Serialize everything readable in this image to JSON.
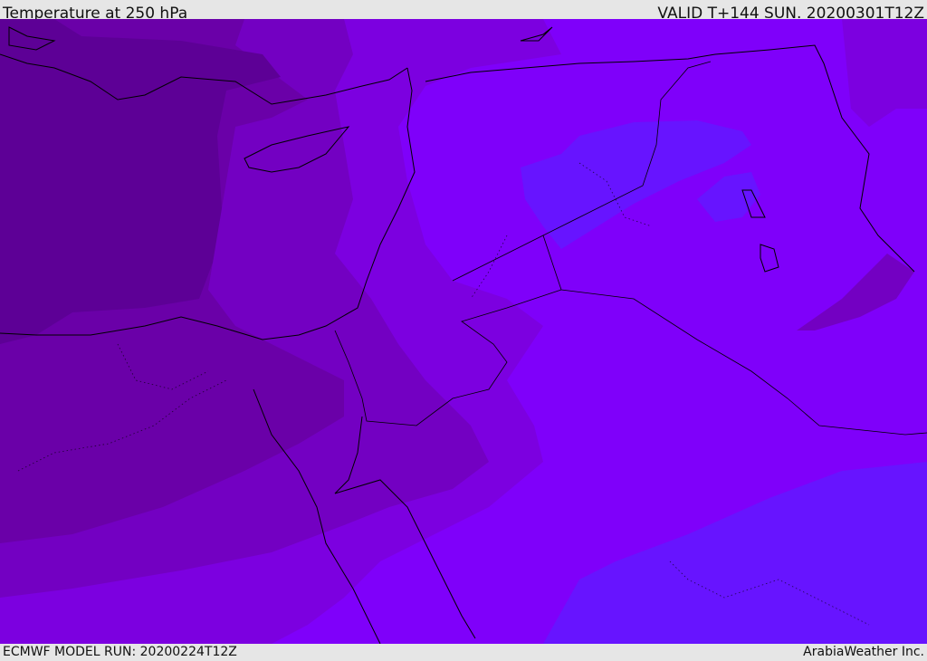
{
  "header": {
    "title": "Temperature at 250 hPa",
    "valid": "VALID T+144 SUN. 20200301T12Z"
  },
  "footer": {
    "model_run": "ECMWF MODEL RUN: 20200224T12Z",
    "credit": "ArabiaWeather Inc."
  },
  "colors": {
    "band_darkest": "#5d0096",
    "band_dark": "#6a00a8",
    "band_mid": "#7300c2",
    "band_light": "#7c00e0",
    "band_bright": "#7f00fa",
    "band_blue": "#6714ff",
    "frame": "#e6e6e6"
  }
}
